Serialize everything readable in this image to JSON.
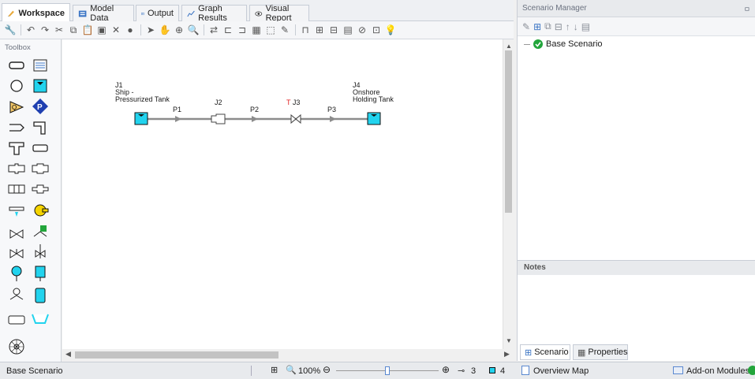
{
  "tabs": [
    {
      "label": "Workspace",
      "active": true
    },
    {
      "label": "Model Data"
    },
    {
      "label": "Output"
    },
    {
      "label": "Graph Results"
    },
    {
      "label": "Visual Report"
    }
  ],
  "toolbox": {
    "title": "Toolbox"
  },
  "model": {
    "j1": {
      "id": "J1",
      "line1": "Ship -",
      "line2": "Pressurized Tank"
    },
    "j2": {
      "id": "J2"
    },
    "j3": {
      "prefix": "T",
      "id": "J3"
    },
    "j4": {
      "id": "J4",
      "line1": "Onshore",
      "line2": "Holding Tank"
    },
    "p1": "P1",
    "p2": "P2",
    "p3": "P3"
  },
  "status": {
    "scenario": "Base Scenario",
    "zoom": "100%",
    "pipe_count": "3",
    "junction_count": "4",
    "overview_map": "Overview Map",
    "addon_modules": "Add-on Modules"
  },
  "scenario_manager": {
    "title": "Scenario Manager",
    "pin": "ㅁ",
    "items": [
      {
        "label": "Base Scenario"
      }
    ]
  },
  "notes": {
    "title": "Notes"
  },
  "bottom_tabs": {
    "scenario": "Scenario",
    "properties": "Properties"
  },
  "colors": {
    "tank": "#22d3ee",
    "pipe": "#8c8c8c",
    "accent": "#1f4e9c",
    "status_green": "#22a53b"
  }
}
